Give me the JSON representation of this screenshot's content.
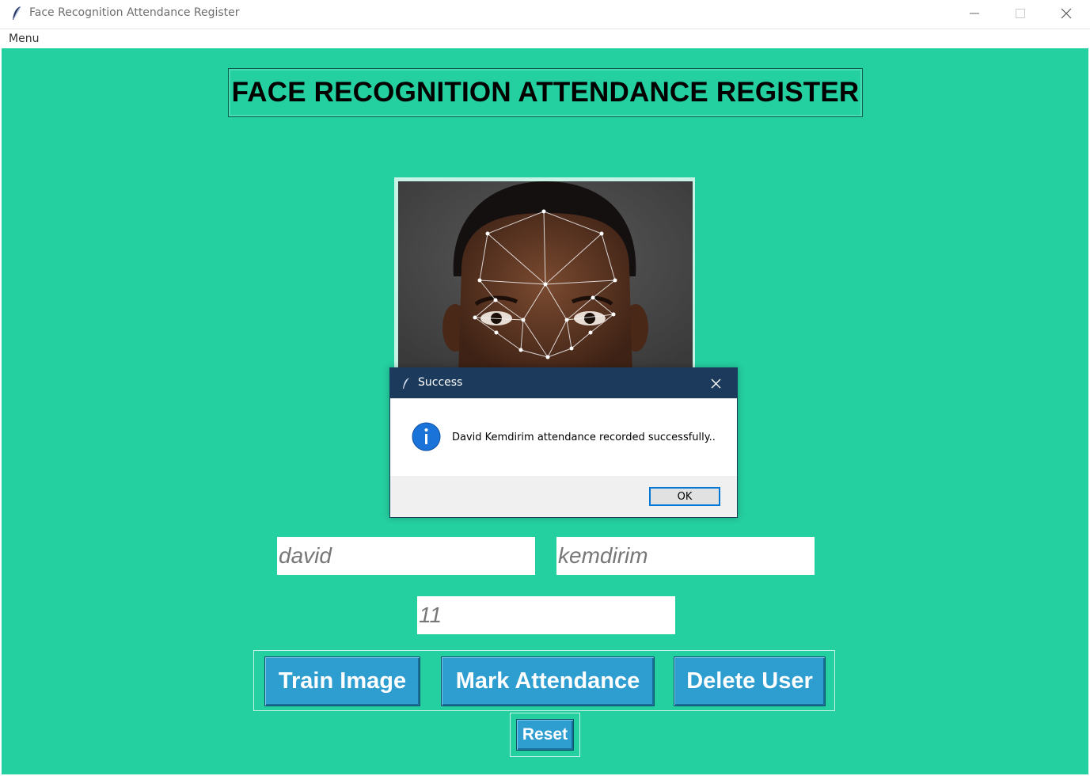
{
  "window": {
    "title": "Face Recognition Attendance Register",
    "controls": [
      "minimize",
      "maximize",
      "close"
    ]
  },
  "menubar": {
    "items": [
      "Menu"
    ]
  },
  "main": {
    "heading": "FACE RECOGNITION ATTENDANCE REGISTER",
    "image_alt": "face-landmark-photo",
    "fields": {
      "first_name": "david",
      "last_name": "kemdirim",
      "user_id": "11"
    },
    "buttons": {
      "train": "Train Image",
      "mark": "Mark Attendance",
      "delete": "Delete User",
      "reset": "Reset"
    },
    "colors": {
      "background": "#24cfa0",
      "button": "#2e9ed0",
      "dialog_title": "#1c3a5c"
    }
  },
  "dialog": {
    "title": "Success",
    "message": "David Kemdirim attendance recorded successfully..",
    "ok_label": "OK",
    "icon": "info-icon"
  }
}
